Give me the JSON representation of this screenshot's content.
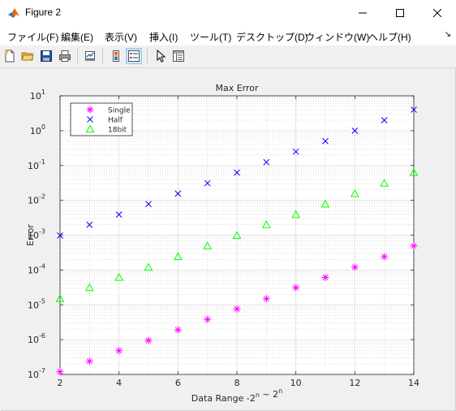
{
  "window": {
    "title": "Figure 2"
  },
  "menu": {
    "items": [
      "ファイル(F)",
      "編集(E)",
      "表示(V)",
      "挿入(I)",
      "ツール(T)",
      "デスクトップ(D)",
      "ウィンドウ(W)",
      "ヘルプ(H)"
    ]
  },
  "toolbar": {
    "buttons": [
      "new-file-icon",
      "open-folder-icon",
      "save-icon",
      "print-icon",
      "link-icon",
      "colorbar-icon",
      "legend-icon",
      "pointer-icon",
      "property-editor-icon"
    ],
    "active": "legend-icon"
  },
  "chart_data": {
    "type": "scatter",
    "title": "Max Error",
    "xlabel": "Data Range -2^n ~ 2^n",
    "ylabel": "Error",
    "xlim": [
      2,
      14
    ],
    "ylim": [
      1e-07,
      10
    ],
    "yscale": "log",
    "grid": "major and minor",
    "x_ticks": [
      2,
      4,
      6,
      8,
      10,
      12,
      14
    ],
    "y_tick_exponents": [
      -7,
      -6,
      -5,
      -4,
      -3,
      -2,
      -1,
      0,
      1
    ],
    "legend": "top-left",
    "series": [
      {
        "name": "Single",
        "marker": "*",
        "color": "#ff00ff",
        "x": [
          2,
          3,
          4,
          5,
          6,
          7,
          8,
          9,
          10,
          11,
          12,
          13,
          14
        ],
        "y": [
          1.2e-07,
          2.4e-07,
          4.8e-07,
          9.5e-07,
          1.9e-06,
          3.8e-06,
          7.6e-06,
          1.5e-05,
          3.1e-05,
          6.1e-05,
          0.00012,
          0.00024,
          0.00049
        ]
      },
      {
        "name": "Half",
        "marker": "x",
        "color": "#0000ff",
        "x": [
          2,
          3,
          4,
          5,
          6,
          7,
          8,
          9,
          10,
          11,
          12,
          13,
          14
        ],
        "y": [
          0.00098,
          0.002,
          0.0039,
          0.0078,
          0.0156,
          0.031,
          0.0625,
          0.125,
          0.25,
          0.5,
          1,
          2,
          4
        ]
      },
      {
        "name": "18bit",
        "marker": "triangle",
        "color": "#00ff00",
        "x": [
          2,
          3,
          4,
          5,
          6,
          7,
          8,
          9,
          10,
          11,
          12,
          13,
          14
        ],
        "y": [
          1.5e-05,
          3.1e-05,
          6.1e-05,
          0.00012,
          0.00024,
          0.00049,
          0.00098,
          0.002,
          0.0039,
          0.0078,
          0.0156,
          0.031,
          0.0625
        ]
      }
    ]
  }
}
